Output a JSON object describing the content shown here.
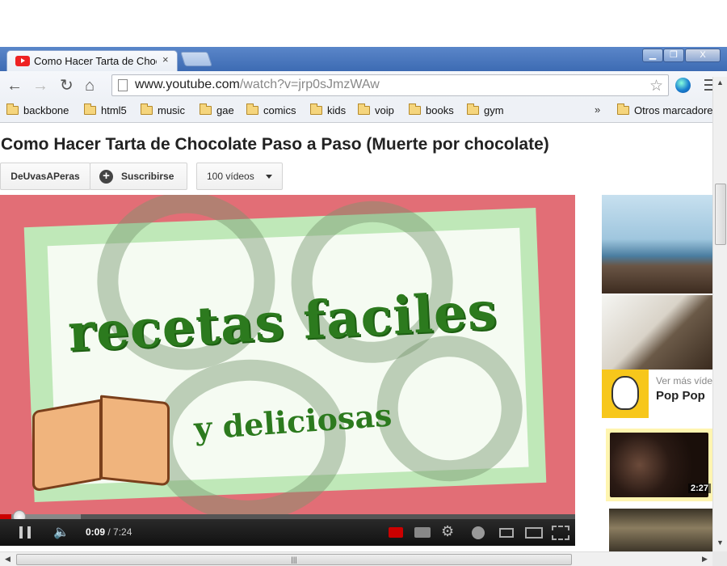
{
  "browser": {
    "tab_title": "Como Hacer Tarta de Chocolate Paso a Paso (Muerte por chocolate) - YouTube",
    "tab_close": "×",
    "window_buttons": {
      "minimize": "▁",
      "maximize": "❐",
      "close": "X"
    },
    "url_host": "www.youtube.com",
    "url_path": "/watch?v=jrp0sJmzWAw",
    "bookmarks": [
      "backbone",
      "html5",
      "music",
      "gae",
      "comics",
      "kids",
      "voip",
      "books",
      "gym"
    ],
    "bookmarks_overflow": "»",
    "other_bookmarks": "Otros marcadores"
  },
  "video": {
    "title": "Como Hacer Tarta de Chocolate Paso a Paso (Muerte por chocolate)",
    "channel": "DeUvasAPeras",
    "subscribe_label": "Suscribirse",
    "videos_label": "100 vídeos",
    "frame_title": "recetas faciles",
    "frame_subtitle": "y deliciosas",
    "current_time": "0:09",
    "duration": "7:24",
    "progress_played": 0.02,
    "progress_buffered": 0.14
  },
  "sidebar": {
    "ad_more": "Ver más vídeos",
    "ad_name": "Pop Pop",
    "third_duration": "2:27"
  },
  "icons": {
    "back": "back-arrow-icon",
    "forward": "forward-arrow-icon",
    "reload": "reload-icon",
    "home": "home-icon",
    "star": "star-icon",
    "menu": "menu-icon"
  },
  "colors": {
    "titlebar": "#4a78c0",
    "progress": "#cc0000",
    "video_bg": "#e26e76",
    "card": "#bfe8b8",
    "text_green": "#2c7a1e"
  }
}
